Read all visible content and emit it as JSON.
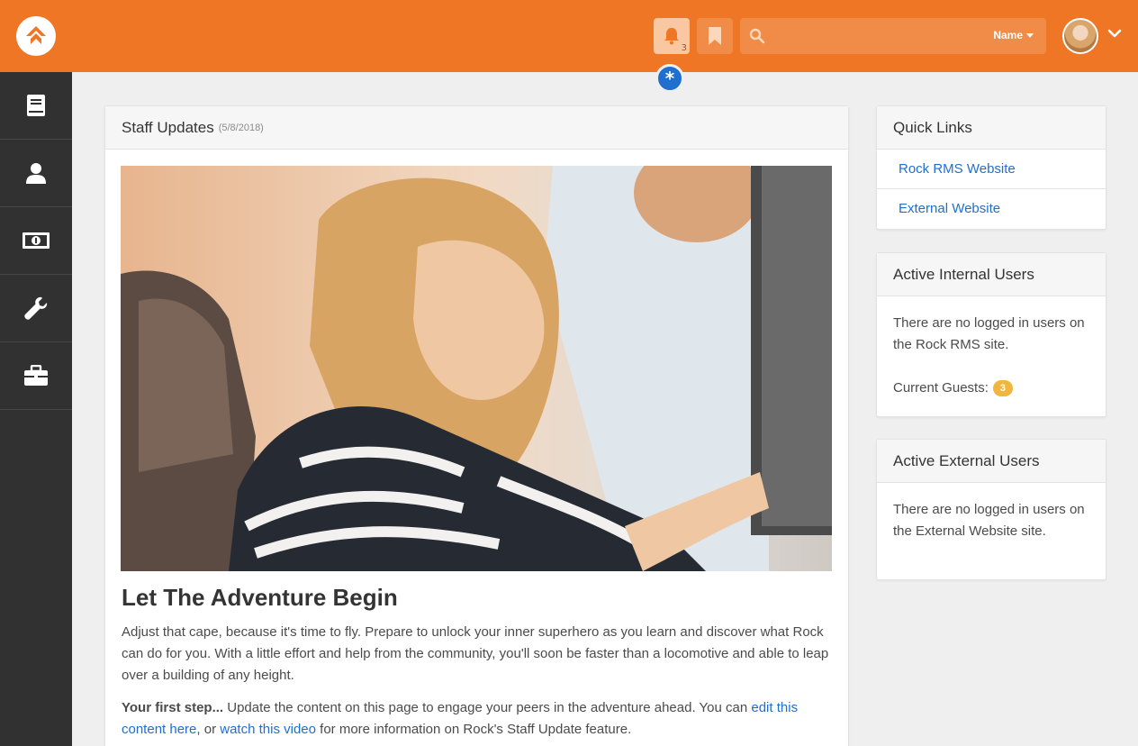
{
  "header": {
    "notifications_count": "3",
    "search": {
      "placeholder": "",
      "filter_label": "Name"
    },
    "admin_badge": "*"
  },
  "sidebar": {
    "items": [
      {
        "icon": "book-icon"
      },
      {
        "icon": "person-icon"
      },
      {
        "icon": "money-icon"
      },
      {
        "icon": "wrench-icon"
      },
      {
        "icon": "briefcase-icon"
      }
    ]
  },
  "staff_updates": {
    "title": "Staff Updates",
    "date": "(5/8/2018)",
    "article_title": "Let The Adventure Begin",
    "paragraph1": "Adjust that cape, because it's time to fly. Prepare to unlock your inner superhero as you learn and discover what Rock can do for you. With a little effort and help from the community, you'll soon be faster than a locomotive and able to leap over a building of any height.",
    "p2_bold": "Your first step...",
    "p2_text1": " Update the content on this page to engage your peers in the adventure ahead. You can ",
    "p2_link1": "edit this content here",
    "p2_text2": ", or ",
    "p2_link2": "watch this video",
    "p2_text3": " for more information on Rock's Staff Update feature."
  },
  "quick_links": {
    "title": "Quick Links",
    "links": [
      "Rock RMS Website",
      "External Website"
    ]
  },
  "active_internal_users": {
    "title": "Active Internal Users",
    "message": "There are no logged in users on the Rock RMS site.",
    "guests_label": "Current Guests:",
    "guests_count": "3"
  },
  "active_external_users": {
    "title": "Active External Users",
    "message": "There are no logged in users on the External Website site."
  }
}
